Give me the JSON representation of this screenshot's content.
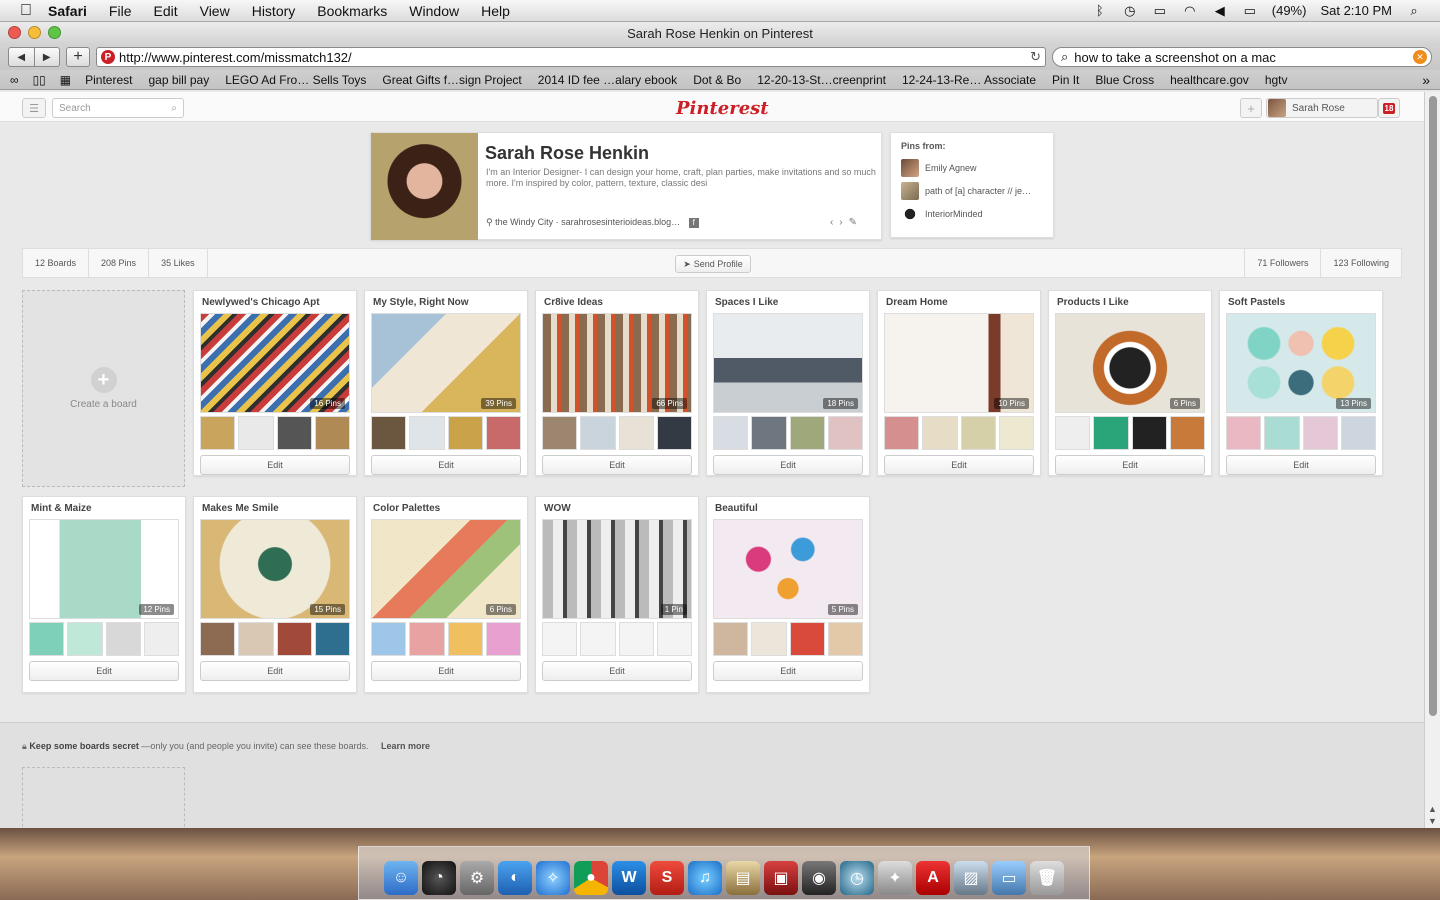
{
  "menubar": {
    "apple": "",
    "app": "Safari",
    "items": [
      "File",
      "Edit",
      "View",
      "History",
      "Bookmarks",
      "Window",
      "Help"
    ],
    "battery": "(49%)",
    "clock": "Sat 2:10 PM"
  },
  "window": {
    "title": "Sarah Rose Henkin on Pinterest",
    "url": "http://www.pinterest.com/missmatch132/",
    "search_query": "how to take a screenshot on a mac"
  },
  "bookmarks": [
    "Pinterest",
    "gap bill pay",
    "LEGO Ad Fro… Sells Toys",
    "Great Gifts f…sign Project",
    "2014 ID fee …alary ebook",
    "Dot & Bo",
    "12-20-13-St…creenprint",
    "12-24-13-Re… Associate",
    "Pin It",
    "Blue Cross",
    "healthcare.gov",
    "hgtv"
  ],
  "pinterest": {
    "search_placeholder": "Search",
    "logo": "Pinterest",
    "user_name": "Sarah Rose",
    "notifications": "18",
    "profile": {
      "name": "Sarah Rose Henkin",
      "bio": "I'm an Interior Designer- I can design your home, craft, plan parties, make invitations and so much more. I'm inspired by color, pattern, texture, classic desi",
      "location": "the Windy City · sarahrosesinterioideas.blog…"
    },
    "pins_from": {
      "title": "Pins from:",
      "items": [
        "Emily Agnew",
        "path of [a] character // je…",
        "InteriorMinded"
      ]
    },
    "stats": {
      "boards": "12 Boards",
      "pins": "208 Pins",
      "likes": "35 Likes",
      "send_profile": "Send Profile",
      "followers": "71 Followers",
      "following": "123 Following"
    },
    "create_board": "Create a board",
    "edit_label": "Edit",
    "boards": [
      {
        "title": "Newlywed's Chicago Apt",
        "count": "16 Pins"
      },
      {
        "title": "My Style, Right Now",
        "count": "39 Pins"
      },
      {
        "title": "Cr8ive Ideas",
        "count": "66 Pins"
      },
      {
        "title": "Spaces I Like",
        "count": "18 Pins"
      },
      {
        "title": "Dream Home",
        "count": "10 Pins"
      },
      {
        "title": "Products I Like",
        "count": "6 Pins"
      },
      {
        "title": "Soft Pastels",
        "count": "13 Pins"
      },
      {
        "title": "Mint & Maize",
        "count": "12 Pins"
      },
      {
        "title": "Makes Me Smile",
        "count": "15 Pins"
      },
      {
        "title": "Color Palettes",
        "count": "6 Pins"
      },
      {
        "title": "WOW",
        "count": "1 Pin"
      },
      {
        "title": "Beautiful",
        "count": "5 Pins"
      }
    ],
    "secret": {
      "bold": "Keep some boards secret",
      "text": " —only you (and people you invite) can see these boards.",
      "learn": "Learn more"
    }
  },
  "colors": {
    "pinterest_red": "#cb2027"
  }
}
